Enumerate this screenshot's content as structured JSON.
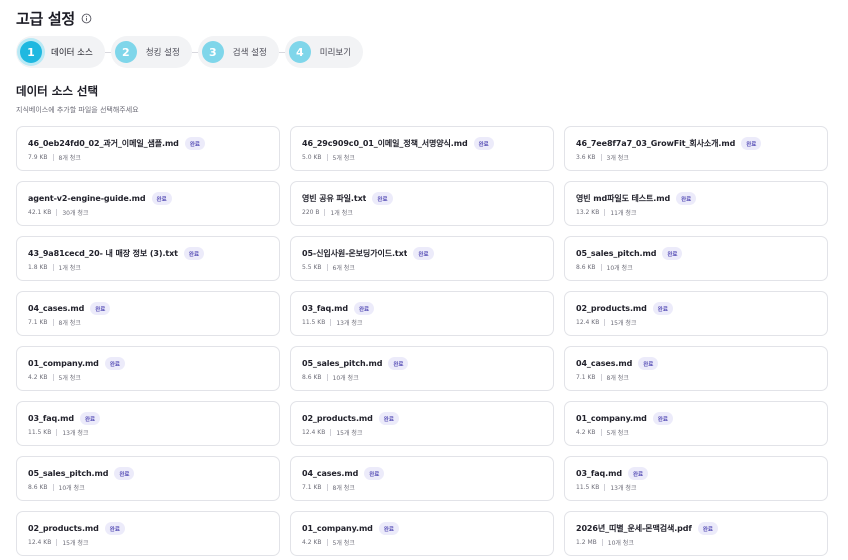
{
  "header": {
    "title": "고급 설정",
    "info_icon": "info-circle-icon"
  },
  "stepper": {
    "steps": [
      {
        "number": "1",
        "label": "데이터 소스",
        "active": true
      },
      {
        "number": "2",
        "label": "청킹 설정",
        "active": false
      },
      {
        "number": "3",
        "label": "검색 설정",
        "active": false
      },
      {
        "number": "4",
        "label": "미리보기",
        "active": false
      }
    ]
  },
  "section": {
    "title": "데이터 소스 선택",
    "subtitle": "지식베이스에 추가할 파일을 선택해주세요"
  },
  "colors": {
    "accent": "#1fb8e0",
    "step_inactive": "#7fd6ea",
    "badge_bg": "#ecebfa",
    "badge_text": "#5b53b8"
  },
  "files": [
    {
      "name": "46_0eb24fd0_02_과거_이메일_샘플.md",
      "status": "완료",
      "size": "7.9 KB",
      "chunks": "8개 청크"
    },
    {
      "name": "46_29c909c0_01_이메일_정책_서명양식.md",
      "status": "완료",
      "size": "5.0 KB",
      "chunks": "5개 청크"
    },
    {
      "name": "46_7ee8f7a7_03_GrowFit_회사소개.md",
      "status": "완료",
      "size": "3.6 KB",
      "chunks": "3개 청크"
    },
    {
      "name": "agent-v2-engine-guide.md",
      "status": "완료",
      "size": "42.1 KB",
      "chunks": "30개 청크"
    },
    {
      "name": "영빈 공유 파일.txt",
      "status": "완료",
      "size": "220 B",
      "chunks": "1개 청크"
    },
    {
      "name": "영빈 md파일도 테스트.md",
      "status": "완료",
      "size": "13.2 KB",
      "chunks": "11개 청크"
    },
    {
      "name": "43_9a81cecd_20- 내 매장 정보 (3).txt",
      "status": "완료",
      "size": "1.8 KB",
      "chunks": "1개 청크"
    },
    {
      "name": "05-신입사원-온보딩가이드.txt",
      "status": "완료",
      "size": "5.5 KB",
      "chunks": "6개 청크"
    },
    {
      "name": "05_sales_pitch.md",
      "status": "완료",
      "size": "8.6 KB",
      "chunks": "10개 청크"
    },
    {
      "name": "04_cases.md",
      "status": "완료",
      "size": "7.1 KB",
      "chunks": "8개 청크"
    },
    {
      "name": "03_faq.md",
      "status": "완료",
      "size": "11.5 KB",
      "chunks": "13개 청크"
    },
    {
      "name": "02_products.md",
      "status": "완료",
      "size": "12.4 KB",
      "chunks": "15개 청크"
    },
    {
      "name": "01_company.md",
      "status": "완료",
      "size": "4.2 KB",
      "chunks": "5개 청크"
    },
    {
      "name": "05_sales_pitch.md",
      "status": "완료",
      "size": "8.6 KB",
      "chunks": "10개 청크"
    },
    {
      "name": "04_cases.md",
      "status": "완료",
      "size": "7.1 KB",
      "chunks": "8개 청크"
    },
    {
      "name": "03_faq.md",
      "status": "완료",
      "size": "11.5 KB",
      "chunks": "13개 청크"
    },
    {
      "name": "02_products.md",
      "status": "완료",
      "size": "12.4 KB",
      "chunks": "15개 청크"
    },
    {
      "name": "01_company.md",
      "status": "완료",
      "size": "4.2 KB",
      "chunks": "5개 청크"
    },
    {
      "name": "05_sales_pitch.md",
      "status": "완료",
      "size": "8.6 KB",
      "chunks": "10개 청크"
    },
    {
      "name": "04_cases.md",
      "status": "완료",
      "size": "7.1 KB",
      "chunks": "8개 청크"
    },
    {
      "name": "03_faq.md",
      "status": "완료",
      "size": "11.5 KB",
      "chunks": "13개 청크"
    },
    {
      "name": "02_products.md",
      "status": "완료",
      "size": "12.4 KB",
      "chunks": "15개 청크"
    },
    {
      "name": "01_company.md",
      "status": "완료",
      "size": "4.2 KB",
      "chunks": "5개 청크"
    },
    {
      "name": "2026년_띠별_운세-몬맥검색.pdf",
      "status": "완료",
      "size": "1.2 MB",
      "chunks": "10개 청크"
    }
  ]
}
